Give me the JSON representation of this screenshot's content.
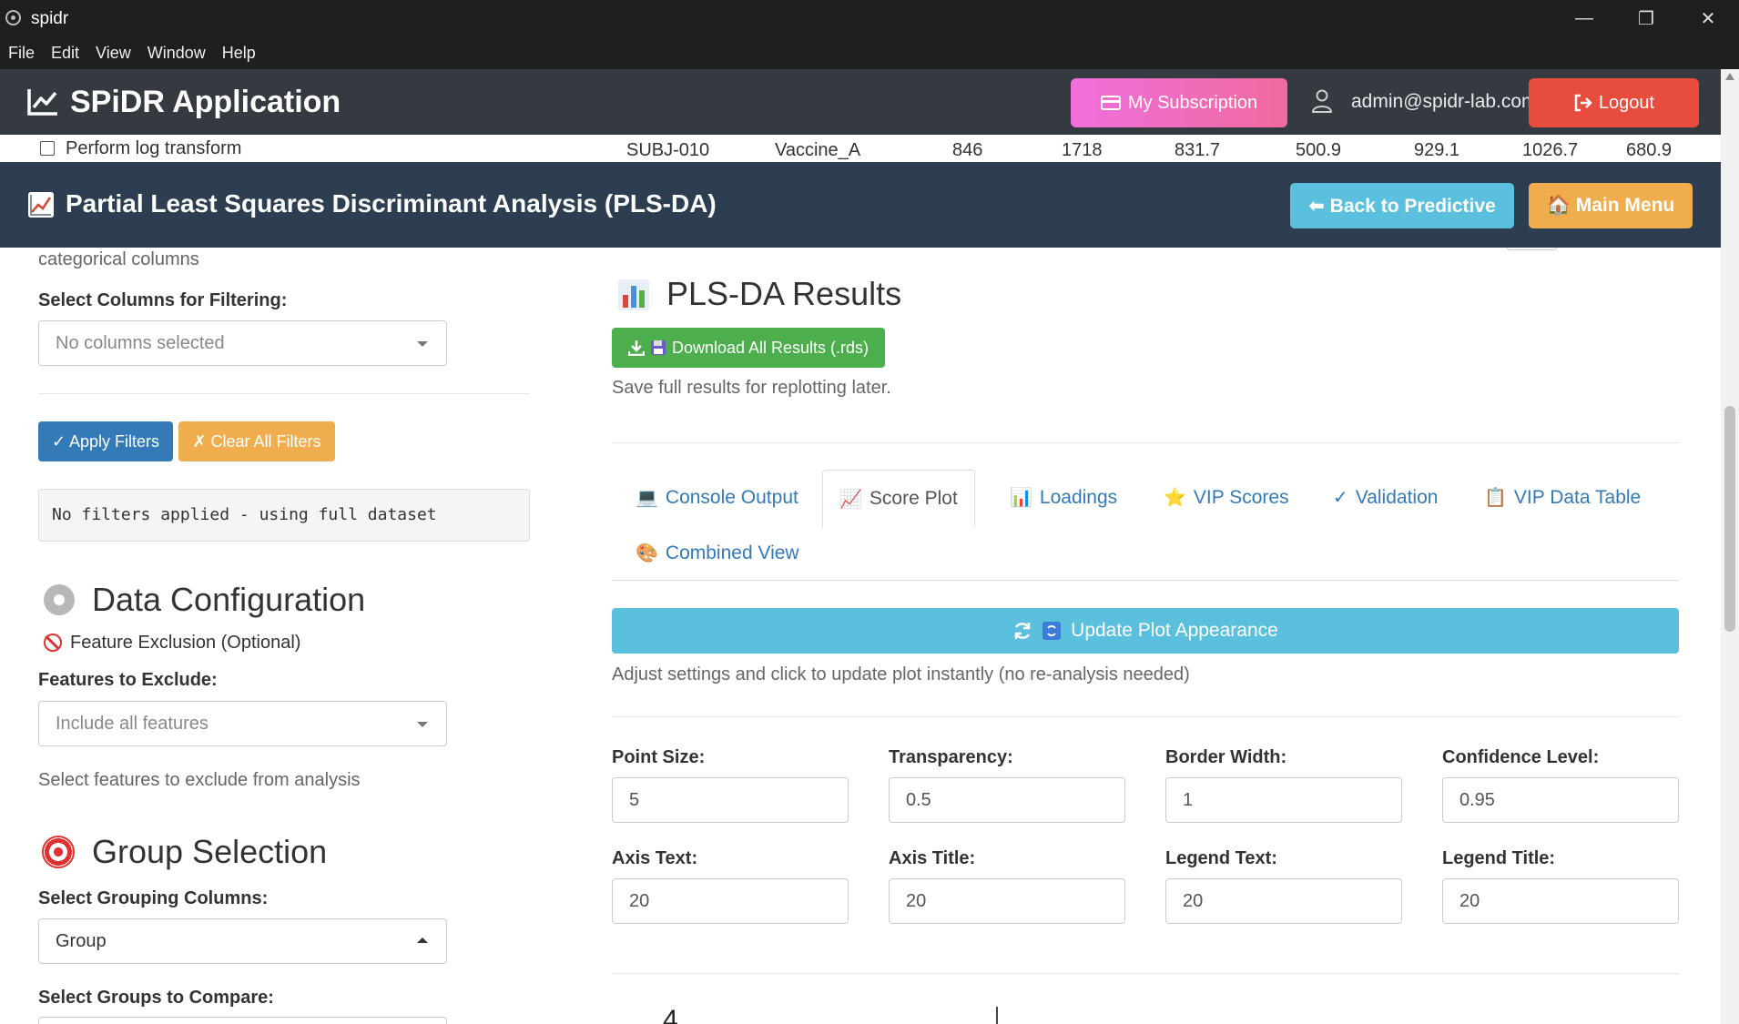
{
  "window": {
    "title": "spidr",
    "minimize_glyph": "—",
    "maximize_glyph": "❐",
    "close_glyph": "✕"
  },
  "menubar": [
    "File",
    "Edit",
    "View",
    "Window",
    "Help"
  ],
  "header": {
    "app_title": "SPiDR Application",
    "subscription_label": "My Subscription",
    "user_email": "admin@spidr-lab.com",
    "logout_label": "Logout"
  },
  "peek_row": {
    "checkbox_label": "Perform log transform",
    "cells": [
      "SUBJ-010",
      "Vaccine_A",
      "846",
      "1718",
      "831.7",
      "500.9",
      "929.1",
      "1026.7",
      "680.9"
    ]
  },
  "section": {
    "title": "Partial Least Squares Discriminant Analysis (PLS-DA)",
    "back_label": "⬅ Back to Predictive",
    "main_menu_label": "🏠 Main Menu"
  },
  "left": {
    "categorical_note": "categorical columns",
    "filter_columns_label": "Select Columns for Filtering:",
    "filter_columns_value": "No columns selected",
    "apply_label": "✓ Apply Filters",
    "clear_label": "✗ Clear All Filters",
    "filter_status": "No filters applied - using full dataset",
    "data_config_title": "Data Configuration",
    "feature_exclusion_label": "Feature Exclusion (Optional)",
    "features_exclude_label": "Features to Exclude:",
    "features_exclude_value": "Include all features",
    "features_exclude_help": "Select features to exclude from analysis",
    "group_selection_title": "Group Selection",
    "grouping_columns_label": "Select Grouping Columns:",
    "grouping_columns_value": "Group",
    "groups_compare_label": "Select Groups to Compare:"
  },
  "right": {
    "results_title": "PLS-DA Results",
    "download_label": "Download All Results (.rds)",
    "download_help": "Save full results for replotting later.",
    "tabs": [
      {
        "icon": "💻",
        "label": "Console Output"
      },
      {
        "icon": "📈",
        "label": "Score Plot"
      },
      {
        "icon": "📊",
        "label": "Loadings"
      },
      {
        "icon": "⭐",
        "label": "VIP Scores"
      },
      {
        "icon": "✓",
        "label": "Validation"
      },
      {
        "icon": "📋",
        "label": "VIP Data Table"
      },
      {
        "icon": "🎨",
        "label": "Combined View"
      }
    ],
    "update_label": "Update Plot Appearance",
    "update_help": "Adjust settings and click to update plot instantly (no re-analysis needed)",
    "fields": [
      {
        "label": "Point Size:",
        "value": "5"
      },
      {
        "label": "Transparency:",
        "value": "0.5"
      },
      {
        "label": "Border Width:",
        "value": "1"
      },
      {
        "label": "Confidence Level:",
        "value": "0.95"
      },
      {
        "label": "Axis Text:",
        "value": "20"
      },
      {
        "label": "Axis Title:",
        "value": "20"
      },
      {
        "label": "Legend Text:",
        "value": "20"
      },
      {
        "label": "Legend Title:",
        "value": "20"
      }
    ],
    "plot_stub": "4"
  },
  "colors": {
    "header_bg": "#343a40",
    "section_bg": "#2c3e50",
    "info": "#5bc0de",
    "warning": "#f0ad4e",
    "danger": "#e74c3c",
    "success": "#4cae4c",
    "primary": "#337ab7"
  }
}
